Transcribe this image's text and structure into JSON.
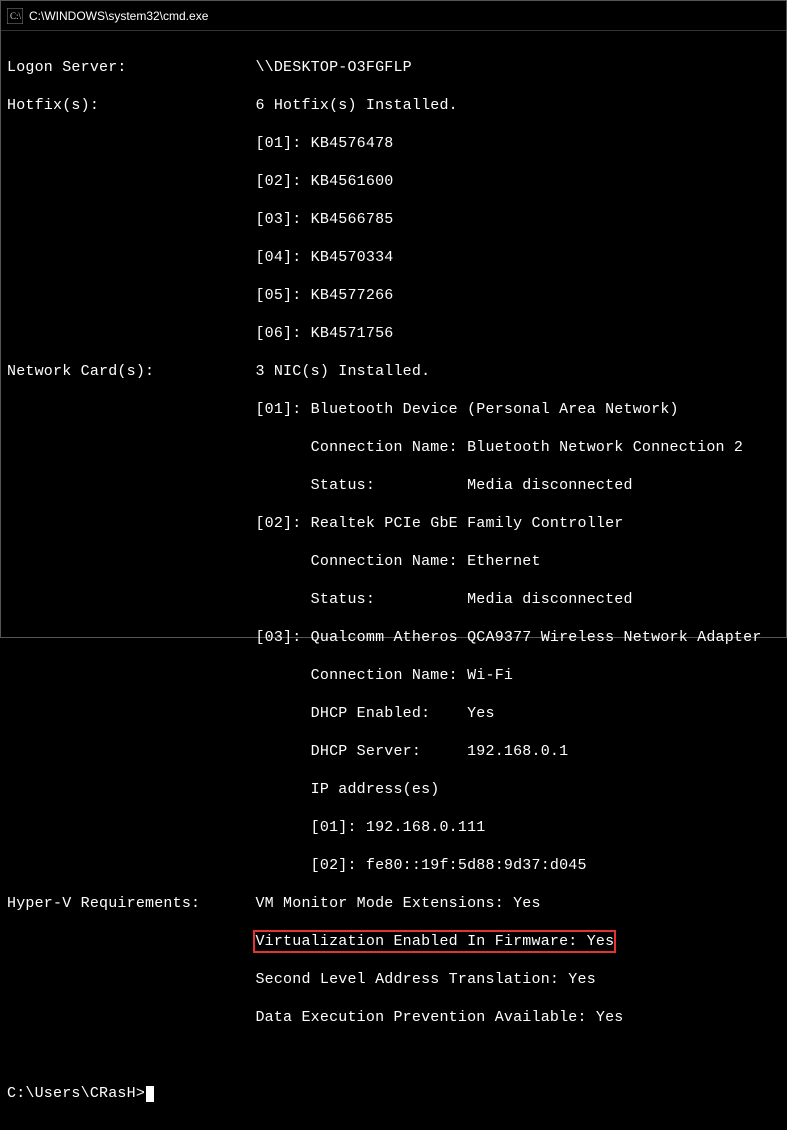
{
  "window": {
    "title": "C:\\WINDOWS\\system32\\cmd.exe"
  },
  "logon_server": {
    "label": "Logon Server:",
    "value": "\\\\DESKTOP-O3FGFLP"
  },
  "hotfixes": {
    "label": "Hotfix(s):",
    "summary": "6 Hotfix(s) Installed.",
    "items": [
      "[01]: KB4576478",
      "[02]: KB4561600",
      "[03]: KB4566785",
      "[04]: KB4570334",
      "[05]: KB4577266",
      "[06]: KB4571756"
    ]
  },
  "network_cards": {
    "label": "Network Card(s):",
    "summary": "3 NIC(s) Installed.",
    "items": [
      "[01]: Bluetooth Device (Personal Area Network)",
      "      Connection Name: Bluetooth Network Connection 2",
      "      Status:          Media disconnected",
      "[02]: Realtek PCIe GbE Family Controller",
      "      Connection Name: Ethernet",
      "      Status:          Media disconnected",
      "[03]: Qualcomm Atheros QCA9377 Wireless Network Adapter",
      "      Connection Name: Wi-Fi",
      "      DHCP Enabled:    Yes",
      "      DHCP Server:     192.168.0.1",
      "      IP address(es)",
      "      [01]: 192.168.0.111",
      "      [02]: fe80::19f:5d88:9d37:d045"
    ]
  },
  "hyperv": {
    "label": "Hyper-V Requirements:",
    "items": [
      "VM Monitor Mode Extensions: Yes",
      "Virtualization Enabled In Firmware: Yes",
      "Second Level Address Translation: Yes",
      "Data Execution Prevention Available: Yes"
    ],
    "highlight_index": 1
  },
  "prompt": "C:\\Users\\CRasH>"
}
